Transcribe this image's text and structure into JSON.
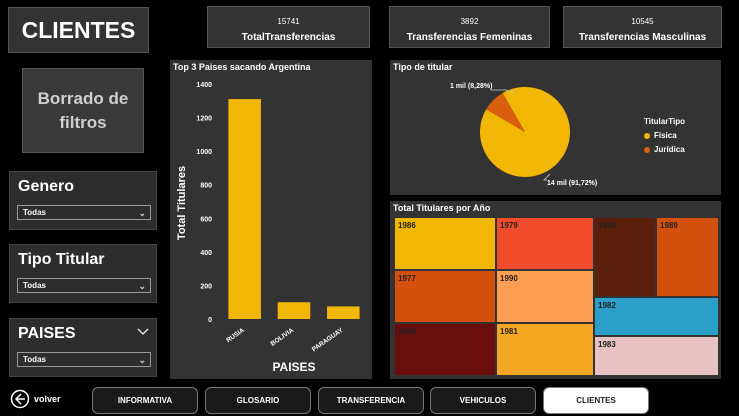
{
  "page_title": "CLIENTES",
  "kpis": [
    {
      "value": "15741",
      "label": "TotalTransferencias"
    },
    {
      "value": "3892",
      "label": "Transferencias Femeninas"
    },
    {
      "value": "10545",
      "label": "Transferencias Masculinas"
    }
  ],
  "clear_filters": {
    "line1": "Borrado de",
    "line2": "filtros"
  },
  "slicers": [
    {
      "label": "Genero",
      "value": "Todas"
    },
    {
      "label": "Tipo Titular",
      "value": "Todas"
    },
    {
      "label": "PAISES",
      "value": "Todas"
    }
  ],
  "colors": {
    "bar": "#f2b705",
    "fisica": "#f2b705",
    "juridica": "#d95f0e"
  },
  "bar_chart": {
    "title": "Top 3 Paises sacando Argentina",
    "chart_data": {
      "type": "bar",
      "title": "Top 3 Paises sacando Argentina",
      "categories": [
        "RUSIA",
        "BOLIVIA",
        "PARAGUAY"
      ],
      "values": [
        1310,
        100,
        75
      ],
      "xlabel": "PAISES",
      "ylabel": "Total Titulares",
      "ylim": [
        0,
        1400
      ],
      "yticks": [
        "0",
        "200",
        "400",
        "600",
        "800",
        "1000",
        "1200",
        "1400"
      ]
    }
  },
  "pie_chart": {
    "title": "Tipo de titular",
    "legend_title": "TitularTipo",
    "legend": [
      "Física",
      "Jurídica"
    ],
    "label_small": "1 mil (8,28%)",
    "label_large": "14 mil (91,72%)",
    "chart_data": {
      "type": "pie",
      "categories": [
        "Física",
        "Jurídica"
      ],
      "values": [
        91.72,
        8.28
      ]
    }
  },
  "treemap": {
    "title": "Total Titulares por Año",
    "cells": [
      {
        "label": "1986",
        "color": "#f2b705"
      },
      {
        "label": "1979",
        "color": "#f04c2c"
      },
      {
        "label": "1980",
        "color": "#5c1f0b"
      },
      {
        "label": "1989",
        "color": "#d3500f"
      },
      {
        "label": "1977",
        "color": "#d3500f"
      },
      {
        "label": "1990",
        "color": "#fb9d52"
      },
      {
        "label": "1982",
        "color": "#2aa0c8"
      },
      {
        "label": "1984",
        "color": "#6a0d0d"
      },
      {
        "label": "1981",
        "color": "#f5a623"
      },
      {
        "label": "1983",
        "color": "#e8c1c3"
      }
    ]
  },
  "back": {
    "label": "volver"
  },
  "nav": [
    "INFORMATIVA",
    "GLOSARIO",
    "TRANSFERENCIA",
    "VEHICULOS",
    "CLIENTES"
  ]
}
